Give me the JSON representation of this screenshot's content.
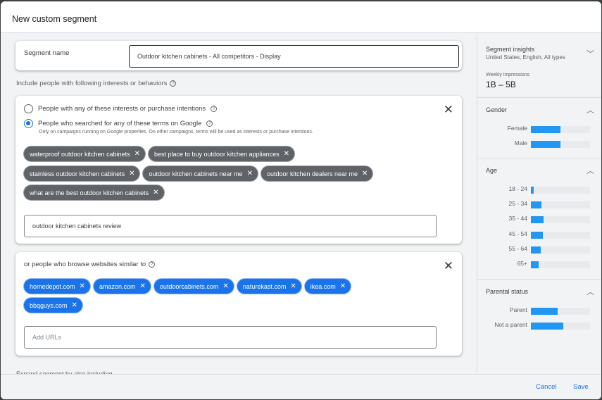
{
  "dialog": {
    "title": "New custom segment"
  },
  "segment_name": {
    "label": "Segment name",
    "value": "Outdoor kitchen cabinets - All competitors - Display"
  },
  "include_label": "Include people with following interests or behaviors",
  "terms_section": {
    "option_interests": "People with any of these interests or purchase intentions",
    "option_searched": "People who searched for any of these terms on Google",
    "selected": "searched",
    "note": "Only on campaigns running on Google properties. On other campaigns, terms will be used as interests or purchase intentions.",
    "chips": [
      "waterproof outdoor kitchen cabinets",
      "best place to buy outdoor kitchen appliances",
      "stainless outdoor kitchen cabinets",
      "outdoor kitchen cabinets near me",
      "outdoor kitchen dealers near me",
      "what are the best outdoor kitchen cabinets"
    ],
    "input_value": "outdoor kitchen cabinets review"
  },
  "websites_section": {
    "label": "or people who browse websites similar to",
    "chips": [
      "homedepot.com",
      "amazon.com",
      "outdoorcabinets.com",
      "naturekast.com",
      "ikea.com",
      "bbqguys.com"
    ],
    "input_placeholder": "Add URLs"
  },
  "cutoff_label": "Expand segment by also including",
  "insights": {
    "title": "Segment insights",
    "subtitle": "United States, English, All types",
    "weekly_label": "Weekly impressions",
    "weekly_value": "1B – 5B",
    "gender": {
      "title": "Gender",
      "rows": [
        {
          "label": "Female",
          "pct": 50
        },
        {
          "label": "Male",
          "pct": 50
        }
      ]
    },
    "age": {
      "title": "Age",
      "rows": [
        {
          "label": "18 - 24",
          "pct": 5
        },
        {
          "label": "25 - 34",
          "pct": 18
        },
        {
          "label": "35 - 44",
          "pct": 22
        },
        {
          "label": "45 - 54",
          "pct": 20
        },
        {
          "label": "55 - 64",
          "pct": 17
        },
        {
          "label": "65+",
          "pct": 13
        }
      ]
    },
    "parental": {
      "title": "Parental status",
      "rows": [
        {
          "label": "Parent",
          "pct": 45
        },
        {
          "label": "Not a parent",
          "pct": 55
        }
      ]
    }
  },
  "footer": {
    "cancel": "Cancel",
    "save": "Save"
  },
  "icons": {
    "close": "✕",
    "chip_remove": "✕",
    "help": "?",
    "chevron_down": "﹀",
    "chevron_up": "︿"
  },
  "colors": {
    "accent": "#1a73e8",
    "bar": "#2196f3",
    "chip_dark": "#5f6368"
  }
}
